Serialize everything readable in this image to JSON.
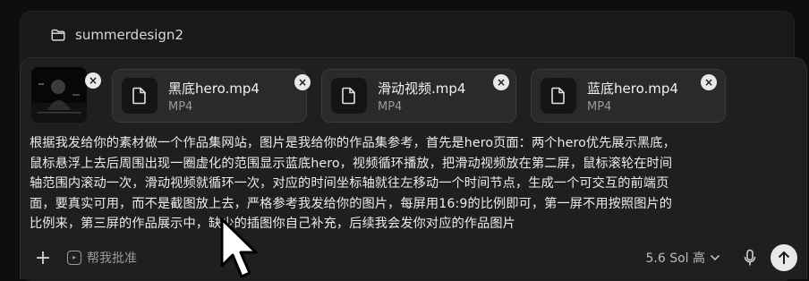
{
  "folder": {
    "name": "summerdesign2",
    "icon": "folder-icon"
  },
  "attachments": {
    "image_thumb": {
      "remove_label": "×"
    },
    "files": [
      {
        "name": "黑底hero.mp4",
        "type": "MP4",
        "remove_label": "×"
      },
      {
        "name": "滑动视频.mp4",
        "type": "MP4",
        "remove_label": "×"
      },
      {
        "name": "蓝底hero.mp4",
        "type": "MP4",
        "remove_label": "×"
      }
    ]
  },
  "message": {
    "lines": [
      "根据我发给你的素材做一个作品集网站，图片是我给你的作品集参考，首先是hero页面：两个hero优先展示黑底，",
      "鼠标悬浮上去后周围出现一圈虚化的范围显示蓝底hero，视频循环播放，把滑动视频放在第二屏，鼠标滚轮在时间",
      "轴范围内滚动一次，滑动视频就循环一次，对应的时间坐标轴就往左移动一个时间节点，生成一个可交互的前端页",
      "面，要真实可用，而不是截图放上去，严格参考我发给你的图片，每屏用16:9的比例即可，第一屏不用按照图片的",
      "比例来，第三屏的作品展示中，缺少的插图你自己补充，后续我会发你对应的作品图片"
    ]
  },
  "toolbar": {
    "plus_label": "+",
    "help_label": "帮我批准",
    "model_label": "5.6 Sol 高",
    "icons": [
      "plus-icon",
      "approve-icon",
      "chevron-down-icon",
      "mic-icon",
      "arrow-up-icon"
    ]
  },
  "colors": {
    "background": "#0e0e0f",
    "composer": "#1f1f21",
    "card": "#2a2a2d",
    "send": "#e8e8e8"
  }
}
